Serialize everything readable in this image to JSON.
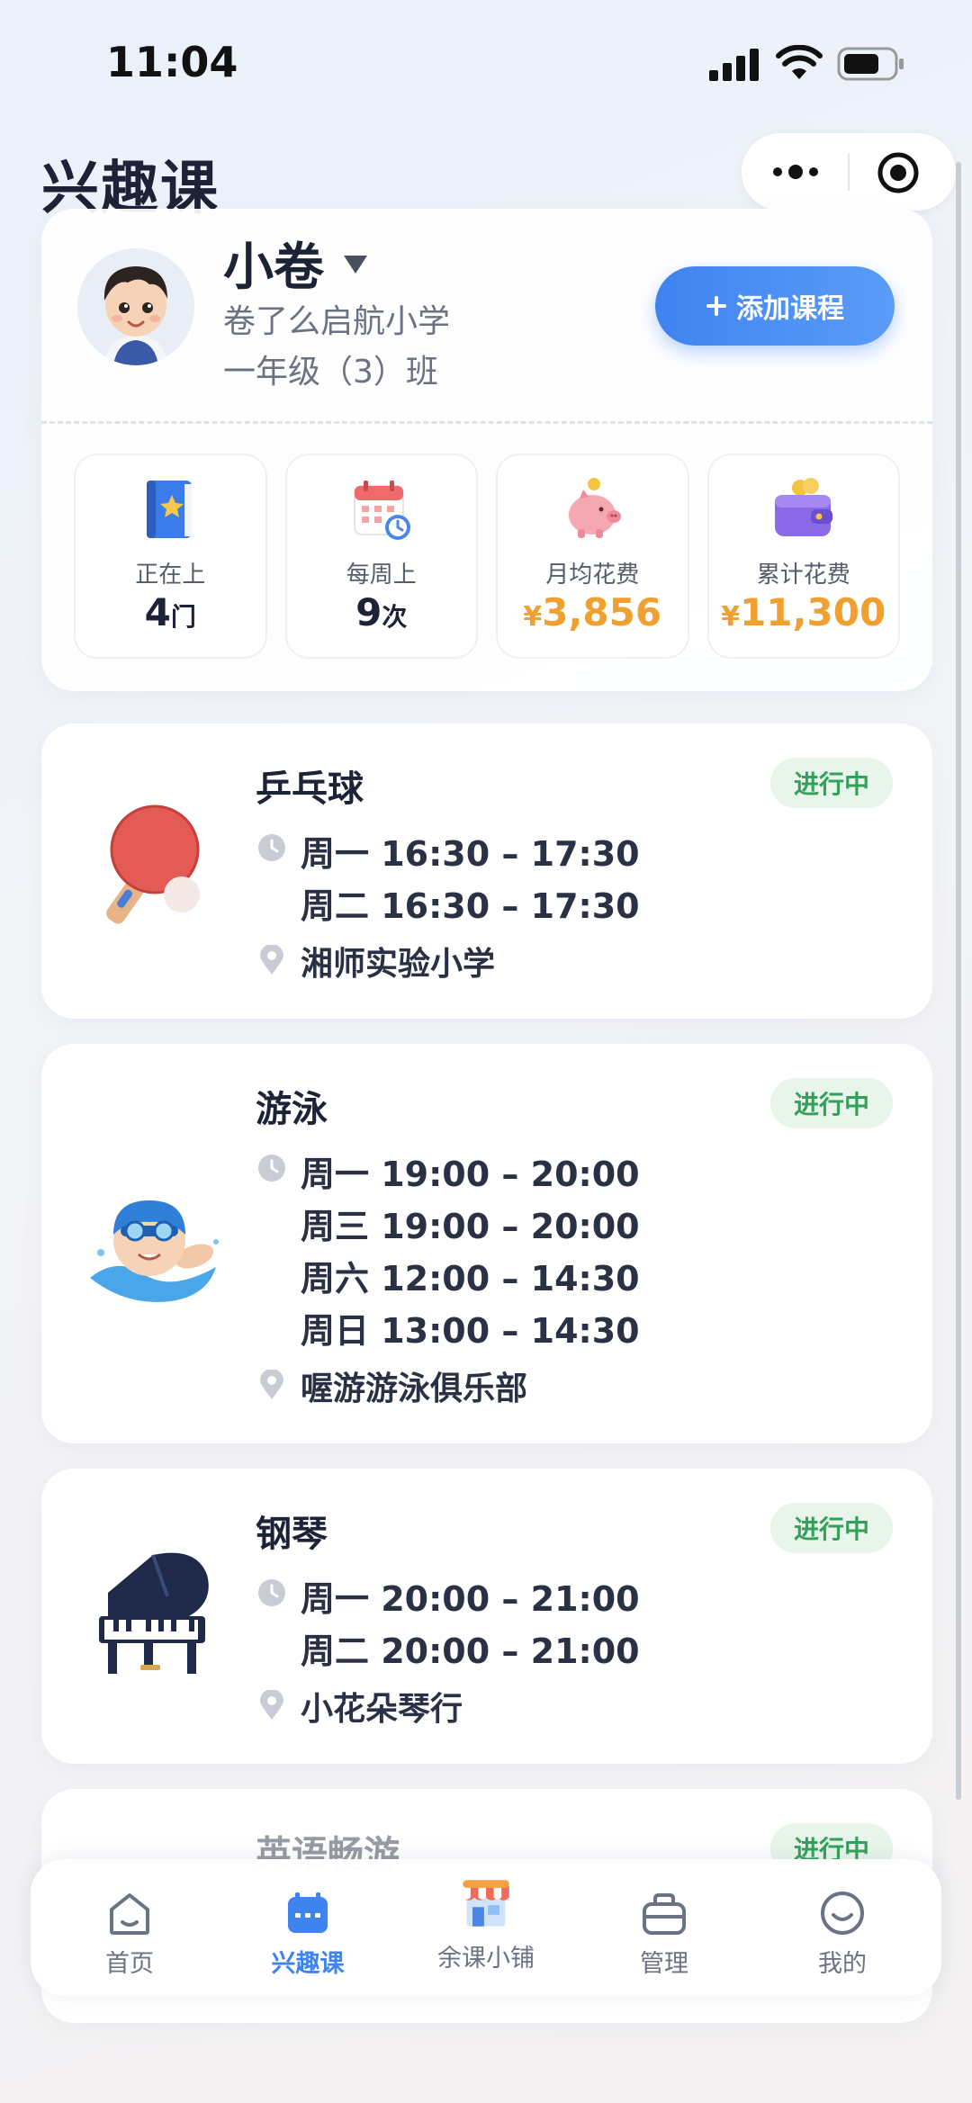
{
  "status_bar": {
    "time": "11:04"
  },
  "header": {
    "title": "兴趣课"
  },
  "profile": {
    "name": "小卷",
    "school": "卷了么启航小学",
    "class": "一年级（3）班",
    "add_button": "添加课程"
  },
  "stats": [
    {
      "label": "正在上",
      "value": "4",
      "unit": "门",
      "icon": "book-icon"
    },
    {
      "label": "每周上",
      "value": "9",
      "unit": "次",
      "icon": "calendar-icon"
    },
    {
      "label": "月均花费",
      "currency": "¥",
      "value": "3,856",
      "icon": "piggy-bank-icon"
    },
    {
      "label": "累计花费",
      "currency": "¥",
      "value": "11,300",
      "icon": "wallet-icon"
    }
  ],
  "courses": [
    {
      "name": "乒乓球",
      "status": "进行中",
      "times": [
        "周一 16:30 – 17:30",
        "周二 16:30 – 17:30"
      ],
      "location": "湘师实验小学",
      "icon": "ping-pong-icon"
    },
    {
      "name": "游泳",
      "status": "进行中",
      "times": [
        "周一 19:00 – 20:00",
        "周三 19:00 – 20:00",
        "周六 12:00 – 14:30",
        "周日 13:00 – 14:30"
      ],
      "location": "喔游游泳俱乐部",
      "icon": "swimmer-icon"
    },
    {
      "name": "钢琴",
      "status": "进行中",
      "times": [
        "周一 20:00 – 21:00",
        "周二 20:00 – 21:00"
      ],
      "location": "小花朵琴行",
      "icon": "piano-icon"
    },
    {
      "name": "英语畅游",
      "status": "进行中"
    }
  ],
  "nav": [
    {
      "label": "首页",
      "icon": "home-icon"
    },
    {
      "label": "兴趣课",
      "icon": "course-icon",
      "active": true
    },
    {
      "label": "余课小铺",
      "icon": "shop-icon"
    },
    {
      "label": "管理",
      "icon": "manage-icon"
    },
    {
      "label": "我的",
      "icon": "profile-icon"
    }
  ],
  "colors": {
    "accent": "#3f83f0",
    "money": "#f0a030",
    "badge_bg": "#e7f5ea",
    "badge_text": "#35a05a"
  }
}
